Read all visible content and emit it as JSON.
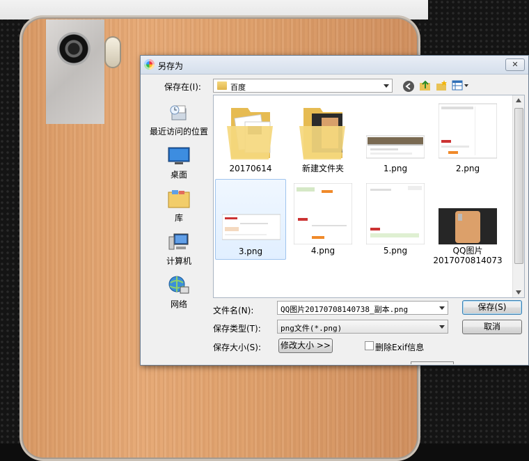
{
  "dialog": {
    "title": "另存为",
    "close_label": "✕",
    "save_in_label": "保存在(I):",
    "save_in_value": "百度",
    "places": [
      {
        "label": "最近访问的位置",
        "icon": "recent-places-icon"
      },
      {
        "label": "桌面",
        "icon": "desktop-icon"
      },
      {
        "label": "库",
        "icon": "libraries-icon"
      },
      {
        "label": "计算机",
        "icon": "computer-icon"
      },
      {
        "label": "网络",
        "icon": "network-icon"
      }
    ],
    "files": [
      {
        "name": "20170614",
        "kind": "folder"
      },
      {
        "name": "新建文件夹",
        "kind": "folder"
      },
      {
        "name": "1.png",
        "kind": "image"
      },
      {
        "name": "2.png",
        "kind": "image"
      },
      {
        "name": "3.png",
        "kind": "image",
        "selected": true
      },
      {
        "name": "4.png",
        "kind": "image"
      },
      {
        "name": "5.png",
        "kind": "image"
      },
      {
        "name": "QQ图片\n2017070814073",
        "kind": "image"
      }
    ],
    "filename_label": "文件名(N):",
    "filename_value": "QQ图片20170708140738_副本.png",
    "filetype_label": "保存类型(T):",
    "filetype_value": "png文件(*.png)",
    "size_label": "保存大小(S):",
    "resize_button": "修改大小 >>",
    "strip_exif_label": "删除Exif信息",
    "strip_exif_checked": false,
    "save_button": "保存(S)",
    "cancel_button": "取消",
    "colors": {
      "accent": "#3c7fb1",
      "selection": "#e1efff"
    }
  }
}
